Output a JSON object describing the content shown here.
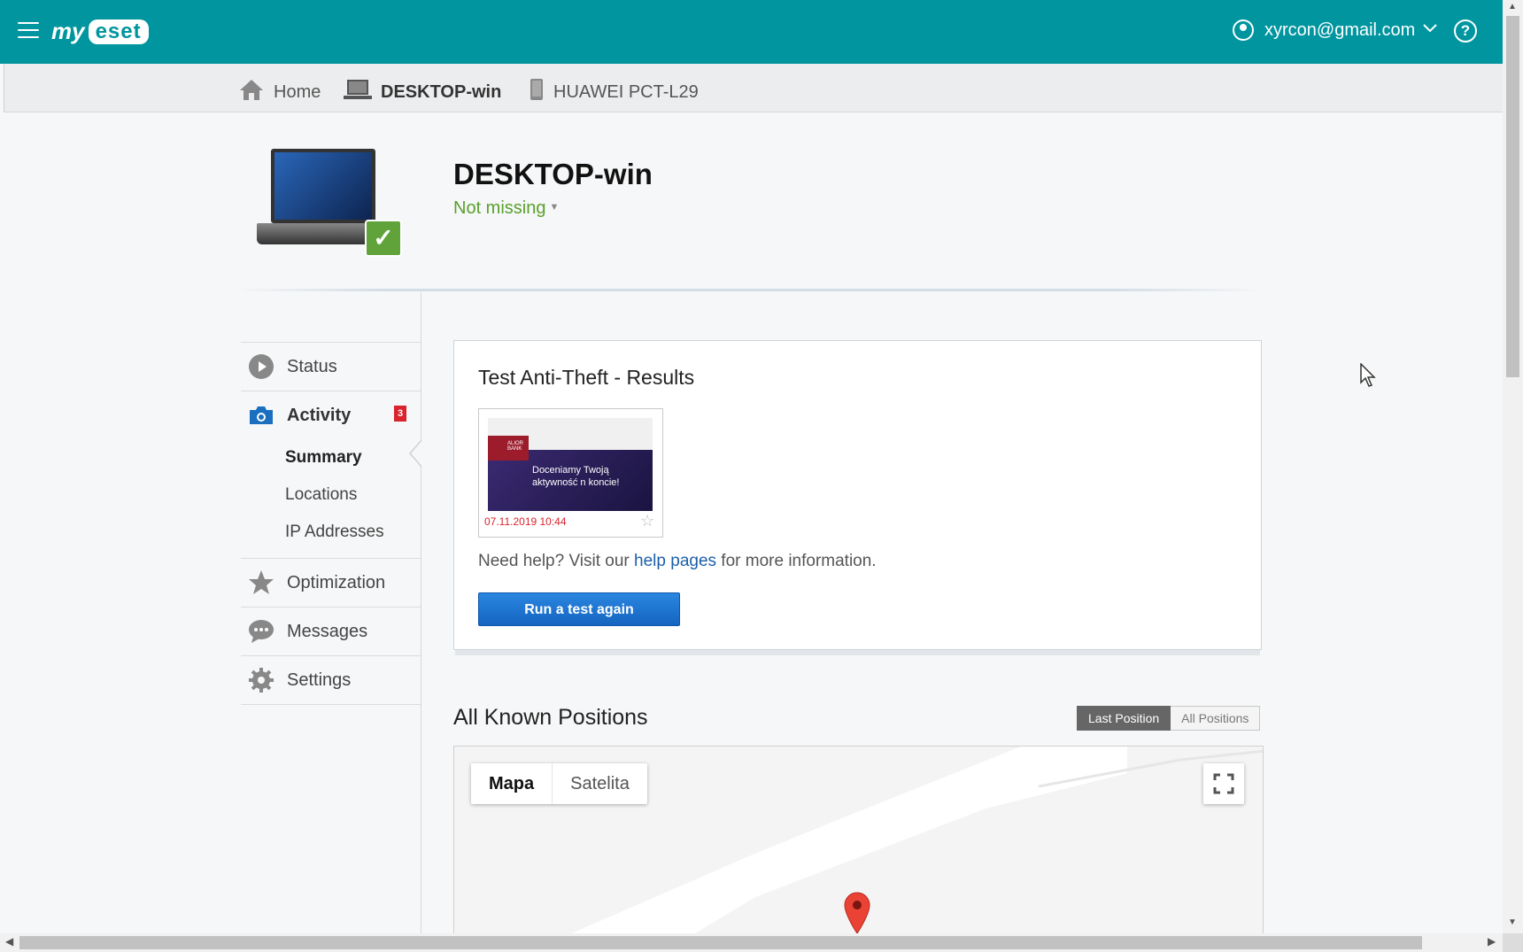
{
  "header": {
    "logo_my": "my",
    "logo_eset": "eset",
    "user_email": "xyrcon@gmail.com",
    "help_symbol": "?",
    "icons": [
      "menu-icon",
      "user-icon",
      "chevron-down-icon",
      "help-icon"
    ]
  },
  "breadcrumb": {
    "items": [
      {
        "label": "Home",
        "icon": "home-icon"
      },
      {
        "label": "DESKTOP-win",
        "icon": "laptop-icon",
        "active": true
      },
      {
        "label": "HUAWEI PCT-L29",
        "icon": "phone-icon"
      }
    ]
  },
  "device": {
    "name": "DESKTOP-win",
    "status": "Not missing",
    "status_color": "#5aa02c"
  },
  "sidebar": {
    "items": [
      {
        "label": "Status",
        "icon": "play-icon"
      },
      {
        "label": "Activity",
        "icon": "camera-icon",
        "badge": "3",
        "active": true
      },
      {
        "label": "Optimization",
        "icon": "star-icon"
      },
      {
        "label": "Messages",
        "icon": "chat-icon"
      },
      {
        "label": "Settings",
        "icon": "gear-icon"
      }
    ],
    "subitems": [
      {
        "label": "Summary",
        "active": true
      },
      {
        "label": "Locations"
      },
      {
        "label": "IP Addresses"
      }
    ]
  },
  "results_card": {
    "title": "Test Anti-Theft - Results",
    "screenshot": {
      "date": "07.11.2019 10:44",
      "banner_text": "Doceniamy Twoją aktywność n koncie!",
      "logo_text": "ALIOR BANK"
    },
    "help_prefix": "Need help? Visit our ",
    "help_link": "help pages",
    "help_suffix": " for more information.",
    "button_label": "Run a test again"
  },
  "positions": {
    "title": "All Known Positions",
    "toggle": [
      "Last Position",
      "All Positions"
    ],
    "map_types": [
      "Mapa",
      "Satelita"
    ]
  },
  "colors": {
    "brand": "#00959f",
    "button": "#1565c0",
    "badge": "#d9232d",
    "link": "#1b5fa8"
  }
}
